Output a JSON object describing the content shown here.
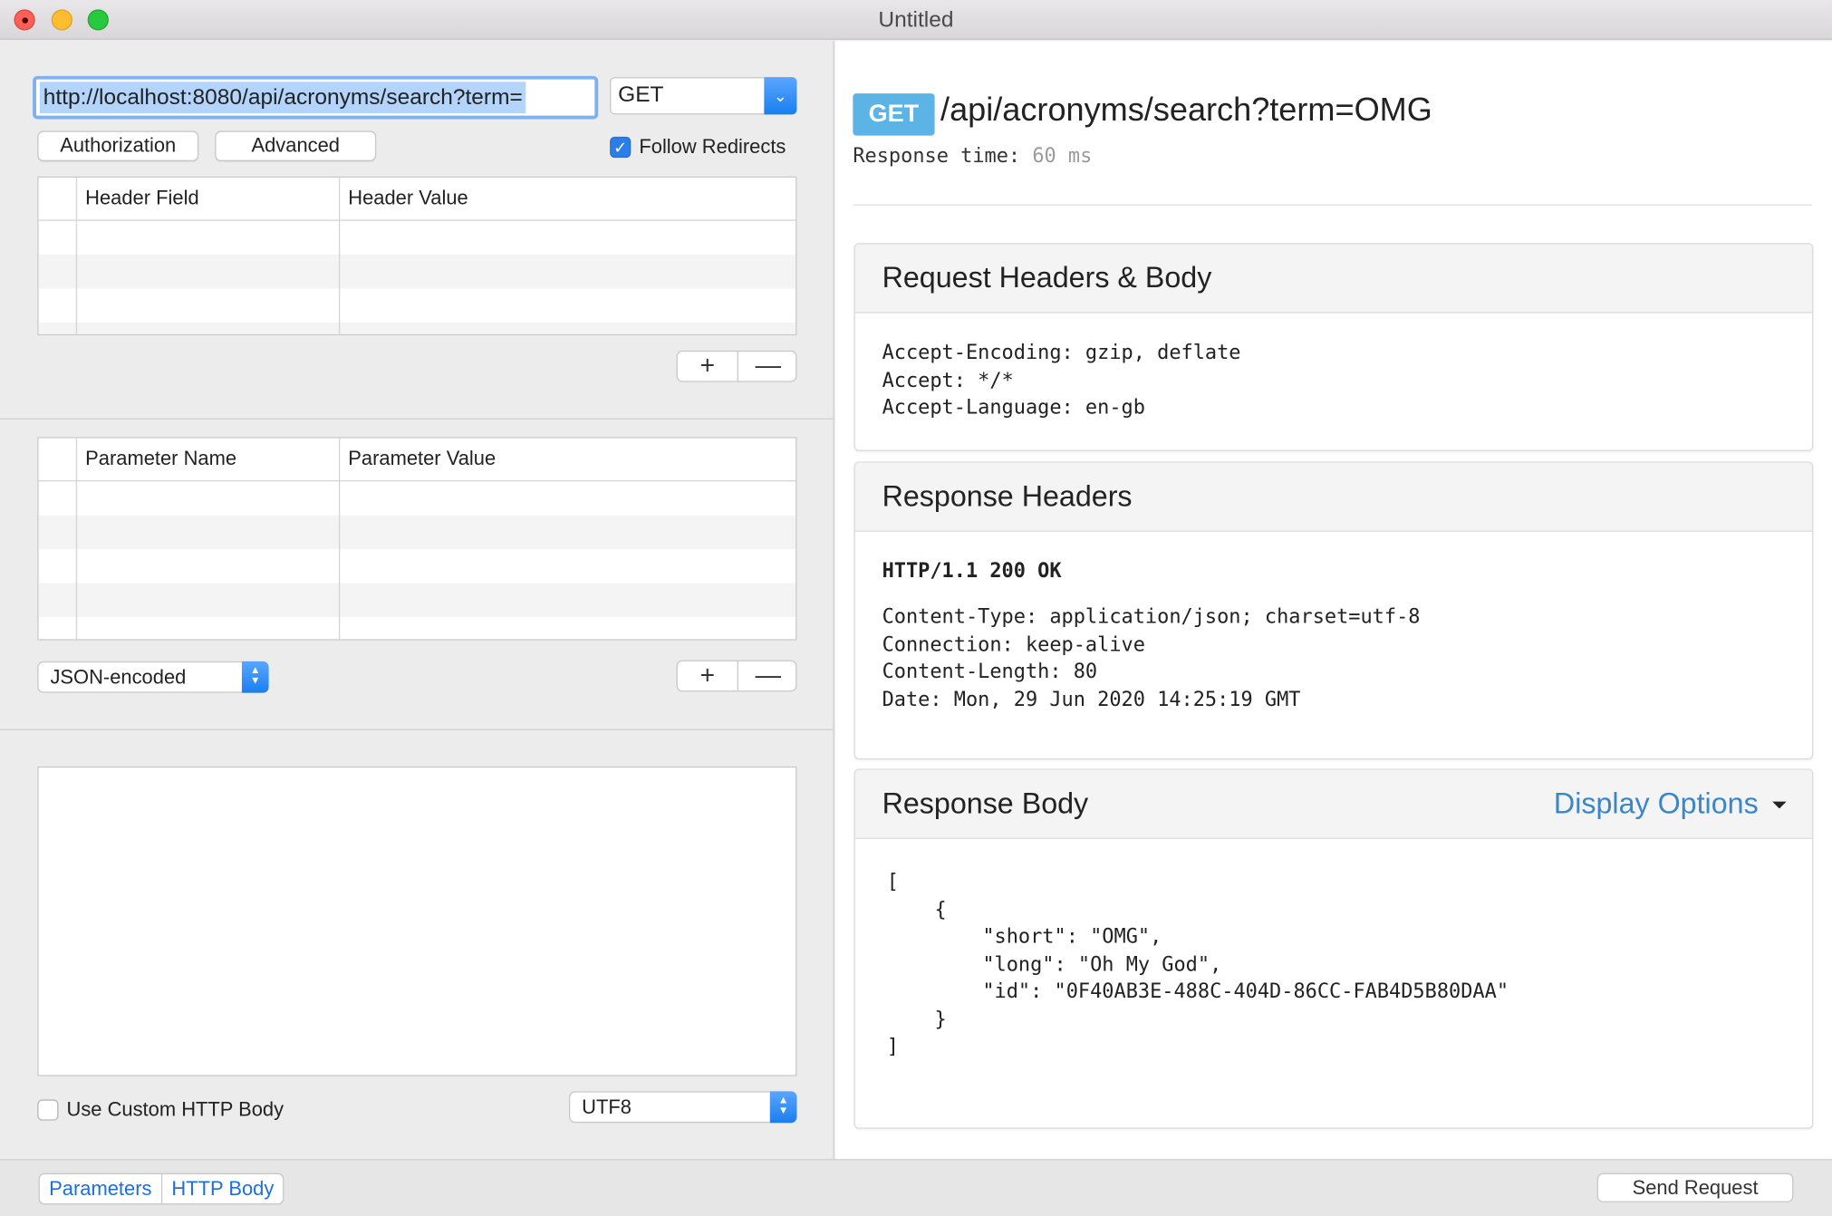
{
  "window": {
    "title": "Untitled"
  },
  "request": {
    "url": "http://localhost:8080/api/acronyms/search?term=",
    "method": "GET",
    "authorization_label": "Authorization",
    "advanced_label": "Advanced",
    "follow_redirects_label": "Follow Redirects",
    "follow_redirects_checked": true
  },
  "headers_table": {
    "columns": [
      "Header Field",
      "Header Value"
    ]
  },
  "params_table": {
    "columns": [
      "Parameter Name",
      "Parameter Value"
    ]
  },
  "encoding_select": {
    "value": "JSON-encoded"
  },
  "body": {
    "use_custom_label": "Use Custom HTTP Body",
    "use_custom_checked": false,
    "charset": "UTF8"
  },
  "bottom": {
    "tabs": [
      "Parameters",
      "HTTP Body"
    ],
    "send_label": "Send Request"
  },
  "response": {
    "method": "GET",
    "path": "/api/acronyms/search?term=OMG",
    "time_label": "Response time:",
    "time_value": "60 ms",
    "request_panel_title": "Request Headers & Body",
    "request_headers": "Accept-Encoding: gzip, deflate\nAccept: */*\nAccept-Language: en-gb",
    "response_headers_title": "Response Headers",
    "status_line": "HTTP/1.1 200 OK",
    "response_headers": "Content-Type: application/json; charset=utf-8\nConnection: keep-alive\nContent-Length: 80\nDate: Mon, 29 Jun 2020 14:25:19 GMT",
    "body_title": "Response Body",
    "display_options": "Display Options",
    "body_text": "[\n    {\n        \"short\": \"OMG\",\n        \"long\": \"Oh My God\",\n        \"id\": \"0F40AB3E-488C-404D-86CC-FAB4D5B80DAA\"\n    }\n]"
  },
  "colors": {
    "accent": "#2b7de9",
    "method_badge": "#5bb3e6",
    "link": "#3a86c8"
  }
}
